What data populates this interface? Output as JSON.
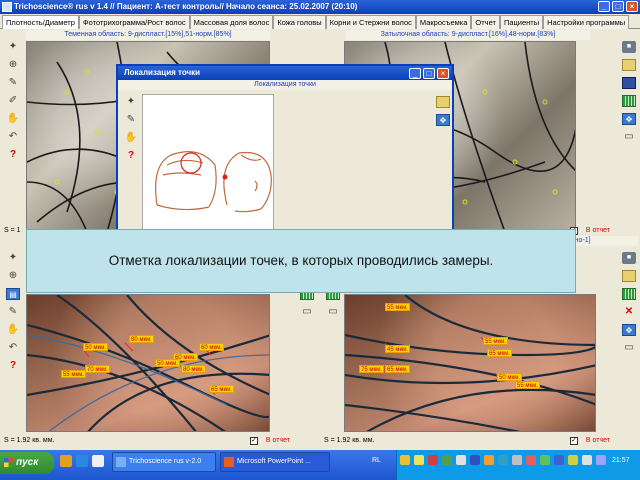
{
  "window": {
    "title": "Trichoscience® rus v 1.4 // Пациент: А-тест контроль// Начало сеанса: 25.02.2007 (20:10)"
  },
  "tabs": [
    "Плотность/Диаметр",
    "Фототрихограмма/Рост волос",
    "Массовая доля волос",
    "Кожа головы",
    "Корни и Стержни волос",
    "Макросъемка",
    "Отчет",
    "Пациенты",
    "Настройки программы"
  ],
  "panels": {
    "top_left": {
      "header": "Теменная область: 9-диспласт.[15%],51-норм.[85%]"
    },
    "top_right": {
      "header": "Затылочная область: 9-диспласт.[16%],48-норм.[83%]"
    },
    "bottom_right": {
      "header_fragment": "жно-1]"
    },
    "footers": {
      "area_top_left": "S = 1",
      "area_bottom_left": "S = 1.92 кв. мм.",
      "area_bottom_right": "S = 1.92 кв. мм.",
      "report_label": "В отчет"
    }
  },
  "measure_labels": {
    "bottom_left": [
      "80 мкм.",
      "50 мкм.",
      "60 мкм.",
      "60 мкм.",
      "50 мкм.",
      "70 мкм.",
      "55 мкм.",
      "80 мкм.",
      "65 мкм.",
      "65 мкм."
    ],
    "bottom_right": [
      "55 мкм.",
      "45 мкм.",
      "55 мкм.",
      "65 мкм.",
      "75 мкм.",
      "65 мкм.",
      "50 мкм.",
      "55 мкм."
    ]
  },
  "dialog": {
    "title": "Локализация точки",
    "subtitle": "Локализация точки"
  },
  "caption": "Отметка локализации точек, в которых проводились замеры.",
  "taskbar": {
    "start": "пуск",
    "tasks": [
      "Trichoscience rus v-2.0",
      "Microsoft PowerPoint ..."
    ],
    "lang": "RL",
    "clock": "21:57"
  },
  "colors": {
    "accent": "#0a3fb8",
    "header_text": "#1e3cc0",
    "label_bg": "#ffd200",
    "report_red": "#e00000",
    "caption_bg": "#bfe3ea"
  },
  "icons": [
    "wand-icon",
    "crosshair-icon",
    "pen-icon",
    "hand-icon",
    "question-icon",
    "camera-icon",
    "folder-icon",
    "grid-icon",
    "cross-icon",
    "disk-icon"
  ]
}
